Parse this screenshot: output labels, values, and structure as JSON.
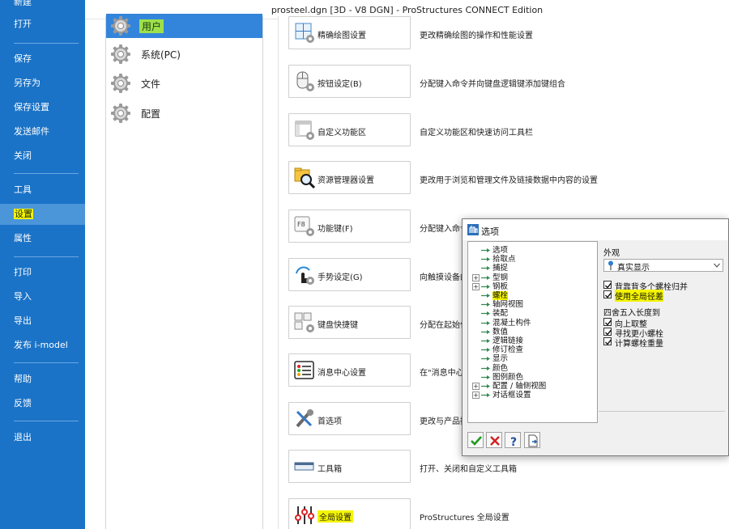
{
  "window": {
    "title": "prosteel.dgn [3D - V8 DGN] - ProStructures CONNECT Edition"
  },
  "backstage": {
    "items": [
      {
        "label": "新建"
      },
      {
        "label": "打开"
      },
      {
        "label": "保存"
      },
      {
        "label": "另存为"
      },
      {
        "label": "保存设置"
      },
      {
        "label": "发送邮件"
      },
      {
        "label": "关闭"
      },
      {
        "label": "工具"
      },
      {
        "label": "设置"
      },
      {
        "label": "属性"
      },
      {
        "label": "打印"
      },
      {
        "label": "导入"
      },
      {
        "label": "导出"
      },
      {
        "label": "发布 i-model"
      },
      {
        "label": "帮助"
      },
      {
        "label": "反馈"
      },
      {
        "label": "退出"
      }
    ],
    "active": "设置"
  },
  "categories": {
    "items": [
      {
        "label": "用户",
        "icon": "gear-icon"
      },
      {
        "label": "系统(PC)",
        "icon": "gear-icon"
      },
      {
        "label": "文件",
        "icon": "gear-icon"
      },
      {
        "label": "配置",
        "icon": "gear-icon"
      }
    ],
    "active": "用户"
  },
  "settings": [
    {
      "label": "精确绘图设置",
      "desc": "更改精确绘图的操作和性能设置",
      "icon": "accudraw-settings-icon"
    },
    {
      "label": "按钮设定(B)",
      "desc": "分配键入命令并向键盘逻辑键添加键组合",
      "icon": "mouse-settings-icon"
    },
    {
      "label": "自定义功能区",
      "desc": "自定义功能区和快速访问工具栏",
      "icon": "customize-ribbon-icon"
    },
    {
      "label": "资源管理器设置",
      "desc": "更改用于浏览和管理文件及链接数据中内容的设置",
      "icon": "explorer-settings-icon"
    },
    {
      "label": "功能键(F)",
      "desc": "分配键入命令",
      "icon": "function-keys-icon"
    },
    {
      "label": "手势设定(G)",
      "desc": "向触摸设备的",
      "icon": "gesture-settings-icon"
    },
    {
      "label": "键盘快捷键",
      "desc": "分配在起始位",
      "icon": "keyboard-shortcuts-icon"
    },
    {
      "label": "消息中心设置",
      "desc": "在\"消息中心\"",
      "icon": "message-center-icon"
    },
    {
      "label": "首选项",
      "desc": "更改与产品操",
      "icon": "preferences-icon"
    },
    {
      "label": "工具箱",
      "desc": "打开、关闭和自定义工具箱",
      "icon": "toolbox-icon"
    },
    {
      "label": "全局设置",
      "desc": "ProStructures 全局设置",
      "icon": "global-settings-icon"
    }
  ],
  "dialog": {
    "title": "选项",
    "tree": [
      {
        "label": "选项",
        "expandable": false
      },
      {
        "label": "拾取点",
        "expandable": false
      },
      {
        "label": "捕捉",
        "expandable": false
      },
      {
        "label": "型钢",
        "expandable": true
      },
      {
        "label": "钢板",
        "expandable": true
      },
      {
        "label": "螺栓",
        "expandable": false,
        "selected": true
      },
      {
        "label": "轴网视图",
        "expandable": false
      },
      {
        "label": "装配",
        "expandable": false
      },
      {
        "label": "混凝土构件",
        "expandable": false
      },
      {
        "label": "数值",
        "expandable": false
      },
      {
        "label": "逻辑链接",
        "expandable": false
      },
      {
        "label": "修订检查",
        "expandable": false
      },
      {
        "label": "显示",
        "expandable": false
      },
      {
        "label": "颜色",
        "expandable": false
      },
      {
        "label": "图例颜色",
        "expandable": false
      },
      {
        "label": "配置 / 轴侧视图",
        "expandable": true
      },
      {
        "label": "对话框设置",
        "expandable": true
      }
    ],
    "appearance_label": "外观",
    "appearance_value": "真实显示",
    "check_group1": [
      {
        "label": "背靠背多个螺栓归并",
        "checked": true
      },
      {
        "label": "使用全局径差",
        "checked": true,
        "highlight": true
      }
    ],
    "rounding_label": "四舍五入长度到",
    "check_group2": [
      {
        "label": "向上取整",
        "checked": true
      },
      {
        "label": "寻找更小螺栓",
        "checked": true
      },
      {
        "label": "计算螺栓重量",
        "checked": true
      }
    ],
    "buttons": [
      {
        "name": "ok-button",
        "icon": "checkmark-icon"
      },
      {
        "name": "cancel-button",
        "icon": "x-icon"
      },
      {
        "name": "help-button",
        "icon": "question-icon"
      },
      {
        "name": "export-button",
        "icon": "document-export-icon"
      }
    ]
  },
  "colors": {
    "backstage_bg": "#1a73c7",
    "backstage_active": "#4b95d9",
    "category_active": "#3385db",
    "highlight_yellow": "#f5f500",
    "highlight_green": "#9ee04a"
  }
}
